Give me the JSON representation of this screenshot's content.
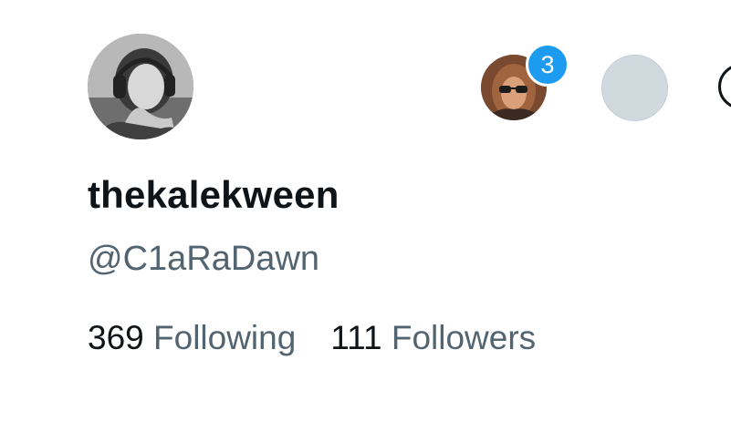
{
  "profile": {
    "display_name": "thekalekween",
    "handle": "@C1aRaDawn",
    "following_count": "369",
    "following_label": "Following",
    "followers_count": "111",
    "followers_label": "Followers"
  },
  "accounts": {
    "notification_count": "3"
  },
  "colors": {
    "badge": "#1d9bf0",
    "primary_text": "#0f1419",
    "secondary_text": "#536471",
    "placeholder_avatar": "#cfd9de"
  },
  "icons": {
    "more": "more-options-icon"
  }
}
